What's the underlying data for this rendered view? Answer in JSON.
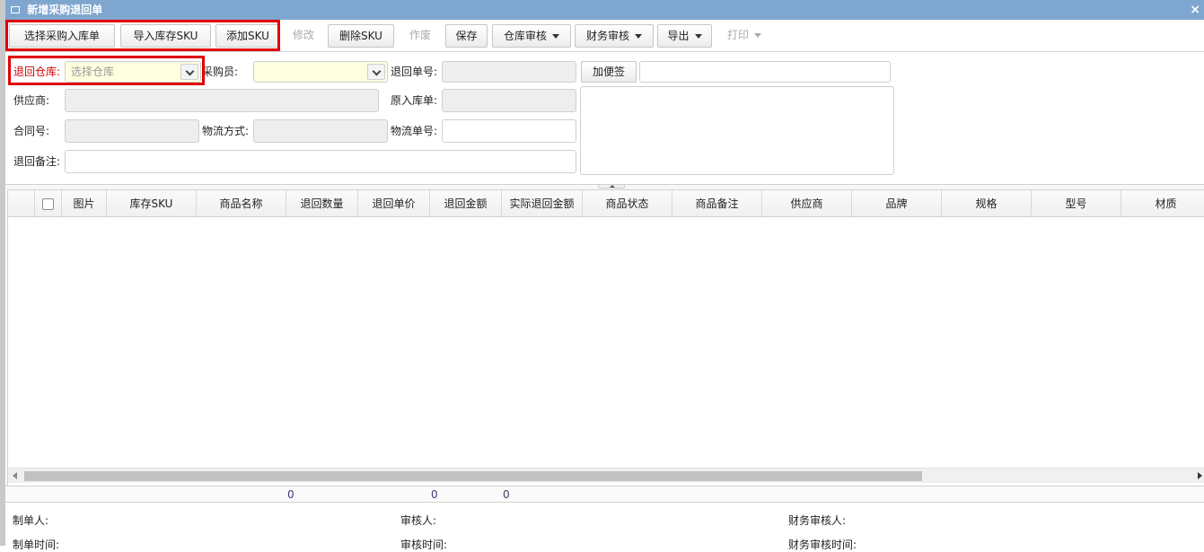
{
  "window": {
    "title": "新增采购退回单",
    "close_glyph": "×"
  },
  "toolbar": {
    "select_inbound": "选择采购入库单",
    "import_sku": "导入库存SKU",
    "add_sku": "添加SKU",
    "modify": "修改",
    "delete_sku": "删除SKU",
    "void": "作废",
    "save": "保存",
    "warehouse_audit": "仓库审核",
    "finance_audit": "财务审核",
    "export": "导出",
    "print": "打印"
  },
  "form": {
    "return_warehouse_label": "退回仓库:",
    "return_warehouse_placeholder": "选择仓库",
    "buyer_label": "采购员:",
    "buyer_value": "",
    "return_no_label": "退回单号:",
    "return_no_value": "",
    "add_note_button": "加便签",
    "note_title_value": "",
    "supplier_label": "供应商:",
    "supplier_value": "",
    "original_inbound_label": "原入库单:",
    "original_inbound_value": "",
    "contract_label": "合同号:",
    "contract_value": "",
    "logistics_method_label": "物流方式:",
    "logistics_method_value": "",
    "logistics_no_label": "物流单号:",
    "logistics_no_value": "",
    "return_remark_label": "退回备注:",
    "return_remark_value": "",
    "note_body_value": ""
  },
  "grid": {
    "columns": [
      "图片",
      "库存SKU",
      "商品名称",
      "退回数量",
      "退回单价",
      "退回金额",
      "实际退回金额",
      "商品状态",
      "商品备注",
      "供应商",
      "品牌",
      "规格",
      "型号",
      "材质"
    ]
  },
  "totals": {
    "qty": "0",
    "amount": "0",
    "actual_amount": "0"
  },
  "signoff": {
    "maker_label": "制单人:",
    "auditor_label": "审核人:",
    "finance_auditor_label": "财务审核人:",
    "make_time_label": "制单时间:",
    "audit_time_label": "审核时间:",
    "finance_audit_time_label": "财务审核时间:"
  },
  "colors": {
    "title_bar": "#7fa6cf",
    "highlight": "#e00000",
    "required_label": "#cc0000"
  },
  "icons": [
    "window-icon",
    "close-icon",
    "chevron-down-icon",
    "caret-down-icon",
    "collapse-arrow-icon",
    "scroll-left-icon",
    "scroll-right-icon"
  ]
}
